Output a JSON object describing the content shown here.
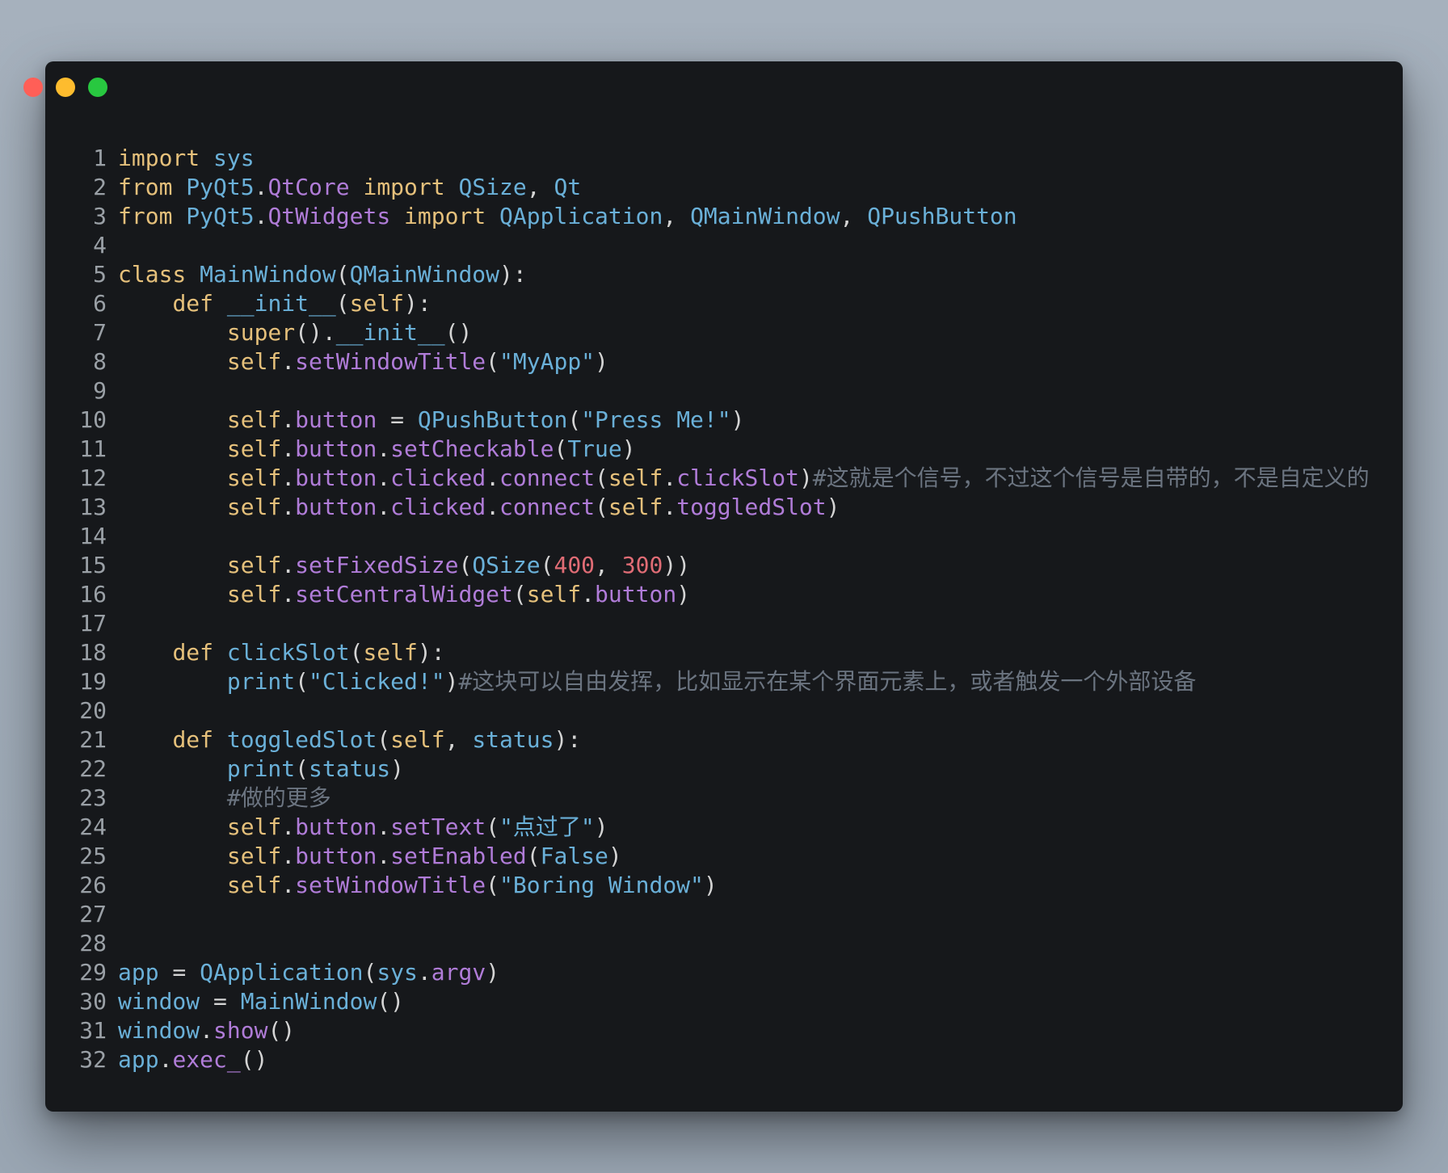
{
  "window": {
    "traffic_lights": [
      {
        "name": "close",
        "color": "#ff5f57"
      },
      {
        "name": "minimize",
        "color": "#febc2e"
      },
      {
        "name": "zoom",
        "color": "#28c840"
      }
    ]
  },
  "colors": {
    "kw": "#e5c07b",
    "id": "#6ab0d8",
    "attr": "#b07cd8",
    "str": "#6ab0d8",
    "num": "#e06c75",
    "cmt": "#6b7480",
    "punc": "#d4d4d4"
  },
  "code": {
    "lines": [
      {
        "n": "1",
        "tokens": [
          [
            "kw",
            "import"
          ],
          [
            "punc",
            " "
          ],
          [
            "id",
            "sys"
          ]
        ]
      },
      {
        "n": "2",
        "tokens": [
          [
            "kw",
            "from"
          ],
          [
            "punc",
            " "
          ],
          [
            "id",
            "PyQt5"
          ],
          [
            "punc",
            "."
          ],
          [
            "attr",
            "QtCore"
          ],
          [
            "punc",
            " "
          ],
          [
            "kw",
            "import"
          ],
          [
            "punc",
            " "
          ],
          [
            "id",
            "QSize"
          ],
          [
            "punc",
            ", "
          ],
          [
            "id",
            "Qt"
          ]
        ]
      },
      {
        "n": "3",
        "tokens": [
          [
            "kw",
            "from"
          ],
          [
            "punc",
            " "
          ],
          [
            "id",
            "PyQt5"
          ],
          [
            "punc",
            "."
          ],
          [
            "attr",
            "QtWidgets"
          ],
          [
            "punc",
            " "
          ],
          [
            "kw",
            "import"
          ],
          [
            "punc",
            " "
          ],
          [
            "id",
            "QApplication"
          ],
          [
            "punc",
            ", "
          ],
          [
            "id",
            "QMainWindow"
          ],
          [
            "punc",
            ", "
          ],
          [
            "id",
            "QPushButton"
          ]
        ]
      },
      {
        "n": "4",
        "tokens": []
      },
      {
        "n": "5",
        "tokens": [
          [
            "kw",
            "class"
          ],
          [
            "punc",
            " "
          ],
          [
            "id",
            "MainWindow"
          ],
          [
            "punc",
            "("
          ],
          [
            "id",
            "QMainWindow"
          ],
          [
            "punc",
            "):"
          ]
        ]
      },
      {
        "n": "6",
        "tokens": [
          [
            "punc",
            "    "
          ],
          [
            "kw",
            "def"
          ],
          [
            "punc",
            " "
          ],
          [
            "id",
            "__init__"
          ],
          [
            "punc",
            "("
          ],
          [
            "kw",
            "self"
          ],
          [
            "punc",
            "):"
          ]
        ]
      },
      {
        "n": "7",
        "tokens": [
          [
            "punc",
            "        "
          ],
          [
            "kw",
            "super"
          ],
          [
            "punc",
            "()."
          ],
          [
            "id",
            "__init__"
          ],
          [
            "punc",
            "()"
          ]
        ]
      },
      {
        "n": "8",
        "tokens": [
          [
            "punc",
            "        "
          ],
          [
            "kw",
            "self"
          ],
          [
            "punc",
            "."
          ],
          [
            "attr",
            "setWindowTitle"
          ],
          [
            "punc",
            "("
          ],
          [
            "str",
            "\"MyApp\""
          ],
          [
            "punc",
            ")"
          ]
        ]
      },
      {
        "n": "9",
        "tokens": []
      },
      {
        "n": "10",
        "tokens": [
          [
            "punc",
            "        "
          ],
          [
            "kw",
            "self"
          ],
          [
            "punc",
            "."
          ],
          [
            "attr",
            "button"
          ],
          [
            "punc",
            " = "
          ],
          [
            "id",
            "QPushButton"
          ],
          [
            "punc",
            "("
          ],
          [
            "str",
            "\"Press Me!\""
          ],
          [
            "punc",
            ")"
          ]
        ]
      },
      {
        "n": "11",
        "tokens": [
          [
            "punc",
            "        "
          ],
          [
            "kw",
            "self"
          ],
          [
            "punc",
            "."
          ],
          [
            "attr",
            "button"
          ],
          [
            "punc",
            "."
          ],
          [
            "attr",
            "setCheckable"
          ],
          [
            "punc",
            "("
          ],
          [
            "id",
            "True"
          ],
          [
            "punc",
            ")"
          ]
        ]
      },
      {
        "n": "12",
        "tokens": [
          [
            "punc",
            "        "
          ],
          [
            "kw",
            "self"
          ],
          [
            "punc",
            "."
          ],
          [
            "attr",
            "button"
          ],
          [
            "punc",
            "."
          ],
          [
            "attr",
            "clicked"
          ],
          [
            "punc",
            "."
          ],
          [
            "attr",
            "connect"
          ],
          [
            "punc",
            "("
          ],
          [
            "kw",
            "self"
          ],
          [
            "punc",
            "."
          ],
          [
            "attr",
            "clickSlot"
          ],
          [
            "punc",
            ")"
          ],
          [
            "cmt",
            "#这就是个信号，不过这个信号是自带的，不是自定义的"
          ]
        ]
      },
      {
        "n": "13",
        "tokens": [
          [
            "punc",
            "        "
          ],
          [
            "kw",
            "self"
          ],
          [
            "punc",
            "."
          ],
          [
            "attr",
            "button"
          ],
          [
            "punc",
            "."
          ],
          [
            "attr",
            "clicked"
          ],
          [
            "punc",
            "."
          ],
          [
            "attr",
            "connect"
          ],
          [
            "punc",
            "("
          ],
          [
            "kw",
            "self"
          ],
          [
            "punc",
            "."
          ],
          [
            "attr",
            "toggledSlot"
          ],
          [
            "punc",
            ")"
          ]
        ]
      },
      {
        "n": "14",
        "tokens": []
      },
      {
        "n": "15",
        "tokens": [
          [
            "punc",
            "        "
          ],
          [
            "kw",
            "self"
          ],
          [
            "punc",
            "."
          ],
          [
            "attr",
            "setFixedSize"
          ],
          [
            "punc",
            "("
          ],
          [
            "id",
            "QSize"
          ],
          [
            "punc",
            "("
          ],
          [
            "num",
            "400"
          ],
          [
            "punc",
            ", "
          ],
          [
            "num",
            "300"
          ],
          [
            "punc",
            "))"
          ]
        ]
      },
      {
        "n": "16",
        "tokens": [
          [
            "punc",
            "        "
          ],
          [
            "kw",
            "self"
          ],
          [
            "punc",
            "."
          ],
          [
            "attr",
            "setCentralWidget"
          ],
          [
            "punc",
            "("
          ],
          [
            "kw",
            "self"
          ],
          [
            "punc",
            "."
          ],
          [
            "attr",
            "button"
          ],
          [
            "punc",
            ")"
          ]
        ]
      },
      {
        "n": "17",
        "tokens": []
      },
      {
        "n": "18",
        "tokens": [
          [
            "punc",
            "    "
          ],
          [
            "kw",
            "def"
          ],
          [
            "punc",
            " "
          ],
          [
            "id",
            "clickSlot"
          ],
          [
            "punc",
            "("
          ],
          [
            "kw",
            "self"
          ],
          [
            "punc",
            "):"
          ]
        ]
      },
      {
        "n": "19",
        "tokens": [
          [
            "punc",
            "        "
          ],
          [
            "id",
            "print"
          ],
          [
            "punc",
            "("
          ],
          [
            "str",
            "\"Clicked!\""
          ],
          [
            "punc",
            ")"
          ],
          [
            "cmt",
            "#这块可以自由发挥，比如显示在某个界面元素上，或者触发一个外部设备"
          ]
        ]
      },
      {
        "n": "20",
        "tokens": []
      },
      {
        "n": "21",
        "tokens": [
          [
            "punc",
            "    "
          ],
          [
            "kw",
            "def"
          ],
          [
            "punc",
            " "
          ],
          [
            "id",
            "toggledSlot"
          ],
          [
            "punc",
            "("
          ],
          [
            "kw",
            "self"
          ],
          [
            "punc",
            ", "
          ],
          [
            "id",
            "status"
          ],
          [
            "punc",
            "):"
          ]
        ]
      },
      {
        "n": "22",
        "tokens": [
          [
            "punc",
            "        "
          ],
          [
            "id",
            "print"
          ],
          [
            "punc",
            "("
          ],
          [
            "id",
            "status"
          ],
          [
            "punc",
            ")"
          ]
        ]
      },
      {
        "n": "23",
        "tokens": [
          [
            "punc",
            "        "
          ],
          [
            "cmt",
            "#做的更多"
          ]
        ]
      },
      {
        "n": "24",
        "tokens": [
          [
            "punc",
            "        "
          ],
          [
            "kw",
            "self"
          ],
          [
            "punc",
            "."
          ],
          [
            "attr",
            "button"
          ],
          [
            "punc",
            "."
          ],
          [
            "attr",
            "setText"
          ],
          [
            "punc",
            "("
          ],
          [
            "str",
            "\"点过了\""
          ],
          [
            "punc",
            ")"
          ]
        ]
      },
      {
        "n": "25",
        "tokens": [
          [
            "punc",
            "        "
          ],
          [
            "kw",
            "self"
          ],
          [
            "punc",
            "."
          ],
          [
            "attr",
            "button"
          ],
          [
            "punc",
            "."
          ],
          [
            "attr",
            "setEnabled"
          ],
          [
            "punc",
            "("
          ],
          [
            "id",
            "False"
          ],
          [
            "punc",
            ")"
          ]
        ]
      },
      {
        "n": "26",
        "tokens": [
          [
            "punc",
            "        "
          ],
          [
            "kw",
            "self"
          ],
          [
            "punc",
            "."
          ],
          [
            "attr",
            "setWindowTitle"
          ],
          [
            "punc",
            "("
          ],
          [
            "str",
            "\"Boring Window\""
          ],
          [
            "punc",
            ")"
          ]
        ]
      },
      {
        "n": "27",
        "tokens": []
      },
      {
        "n": "28",
        "tokens": []
      },
      {
        "n": "29",
        "tokens": [
          [
            "id",
            "app"
          ],
          [
            "punc",
            " = "
          ],
          [
            "id",
            "QApplication"
          ],
          [
            "punc",
            "("
          ],
          [
            "id",
            "sys"
          ],
          [
            "punc",
            "."
          ],
          [
            "attr",
            "argv"
          ],
          [
            "punc",
            ")"
          ]
        ]
      },
      {
        "n": "30",
        "tokens": [
          [
            "id",
            "window"
          ],
          [
            "punc",
            " = "
          ],
          [
            "id",
            "MainWindow"
          ],
          [
            "punc",
            "()"
          ]
        ]
      },
      {
        "n": "31",
        "tokens": [
          [
            "id",
            "window"
          ],
          [
            "punc",
            "."
          ],
          [
            "attr",
            "show"
          ],
          [
            "punc",
            "()"
          ]
        ]
      },
      {
        "n": "32",
        "tokens": [
          [
            "id",
            "app"
          ],
          [
            "punc",
            "."
          ],
          [
            "attr",
            "exec_"
          ],
          [
            "punc",
            "()"
          ]
        ]
      }
    ]
  }
}
